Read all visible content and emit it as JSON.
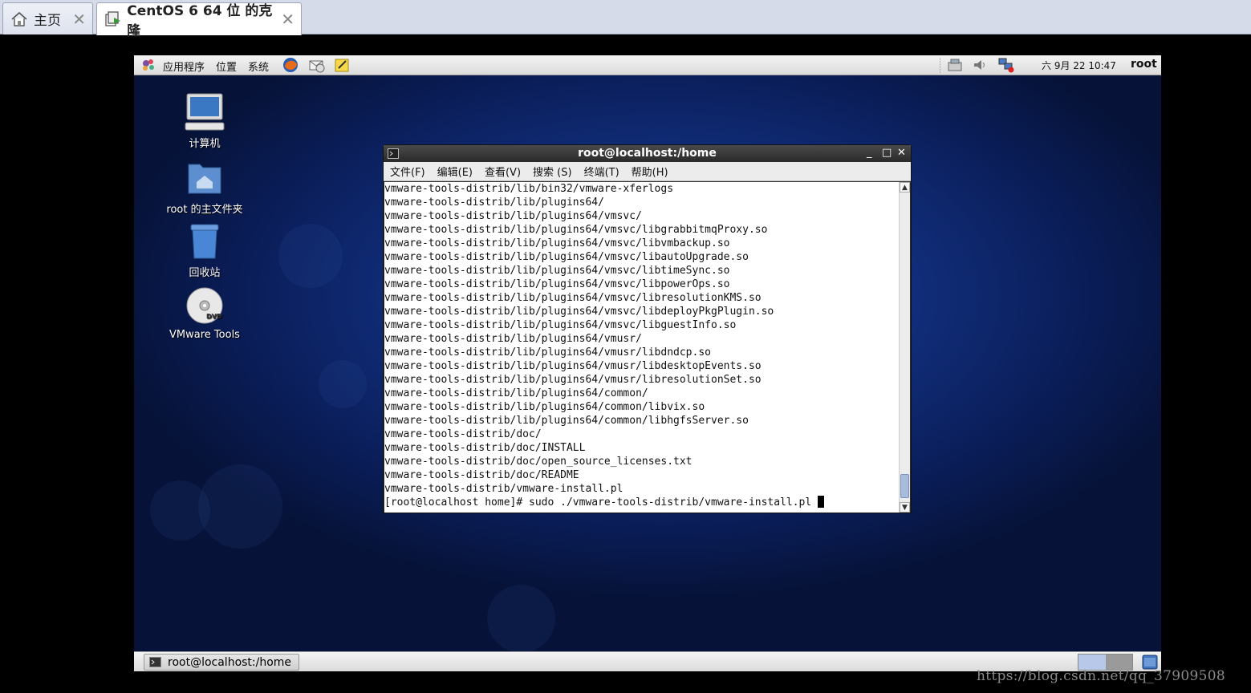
{
  "host_tabs": [
    {
      "label": "主页",
      "icon": "home-icon",
      "close": "✕"
    },
    {
      "label": "CentOS 6 64 位 的克隆",
      "icon": "vm-icon",
      "close": "✕"
    }
  ],
  "gnome_top_panel": {
    "menus": [
      "应用程序",
      "位置",
      "系统"
    ],
    "launchers": [
      "firefox-icon",
      "mail-icon",
      "notes-icon"
    ],
    "tray": [
      "network-icon",
      "volume-icon",
      "network-offline-icon"
    ],
    "clock": "六 9月 22 10:47",
    "user": "root"
  },
  "desktop_icons": [
    {
      "label": "计算机",
      "icon": "computer-icon"
    },
    {
      "label": "root 的主文件夹",
      "icon": "home-folder-icon"
    },
    {
      "label": "回收站",
      "icon": "trash-icon"
    },
    {
      "label": "VMware Tools",
      "icon": "dvd-icon"
    }
  ],
  "terminal": {
    "title": "root@localhost:/home",
    "controls": {
      "minimize": "_",
      "maximize": "□",
      "close": "✕"
    },
    "menu": [
      "文件(F)",
      "编辑(E)",
      "查看(V)",
      "搜索 (S)",
      "终端(T)",
      "帮助(H)"
    ],
    "lines": [
      "vmware-tools-distrib/lib/bin32/vmware-xferlogs",
      "vmware-tools-distrib/lib/plugins64/",
      "vmware-tools-distrib/lib/plugins64/vmsvc/",
      "vmware-tools-distrib/lib/plugins64/vmsvc/libgrabbitmqProxy.so",
      "vmware-tools-distrib/lib/plugins64/vmsvc/libvmbackup.so",
      "vmware-tools-distrib/lib/plugins64/vmsvc/libautoUpgrade.so",
      "vmware-tools-distrib/lib/plugins64/vmsvc/libtimeSync.so",
      "vmware-tools-distrib/lib/plugins64/vmsvc/libpowerOps.so",
      "vmware-tools-distrib/lib/plugins64/vmsvc/libresolutionKMS.so",
      "vmware-tools-distrib/lib/plugins64/vmsvc/libdeployPkgPlugin.so",
      "vmware-tools-distrib/lib/plugins64/vmsvc/libguestInfo.so",
      "vmware-tools-distrib/lib/plugins64/vmusr/",
      "vmware-tools-distrib/lib/plugins64/vmusr/libdndcp.so",
      "vmware-tools-distrib/lib/plugins64/vmusr/libdesktopEvents.so",
      "vmware-tools-distrib/lib/plugins64/vmusr/libresolutionSet.so",
      "vmware-tools-distrib/lib/plugins64/common/",
      "vmware-tools-distrib/lib/plugins64/common/libvix.so",
      "vmware-tools-distrib/lib/plugins64/common/libhgfsServer.so",
      "vmware-tools-distrib/doc/",
      "vmware-tools-distrib/doc/INSTALL",
      "vmware-tools-distrib/doc/open_source_licenses.txt",
      "vmware-tools-distrib/doc/README",
      "vmware-tools-distrib/vmware-install.pl"
    ],
    "prompt": "[root@localhost home]# sudo ./vmware-tools-distrib/vmware-install.pl "
  },
  "gnome_bottom_panel": {
    "task": "root@localhost:/home",
    "workspace_colors": [
      "#b8c8e8",
      "#9a9a9a"
    ]
  },
  "watermark": "https://blog.csdn.net/qq_37909508",
  "colors": {
    "desktop": "#12307f",
    "terminal_bg": "#ffffff",
    "titlebar": "#3a3a3a"
  }
}
